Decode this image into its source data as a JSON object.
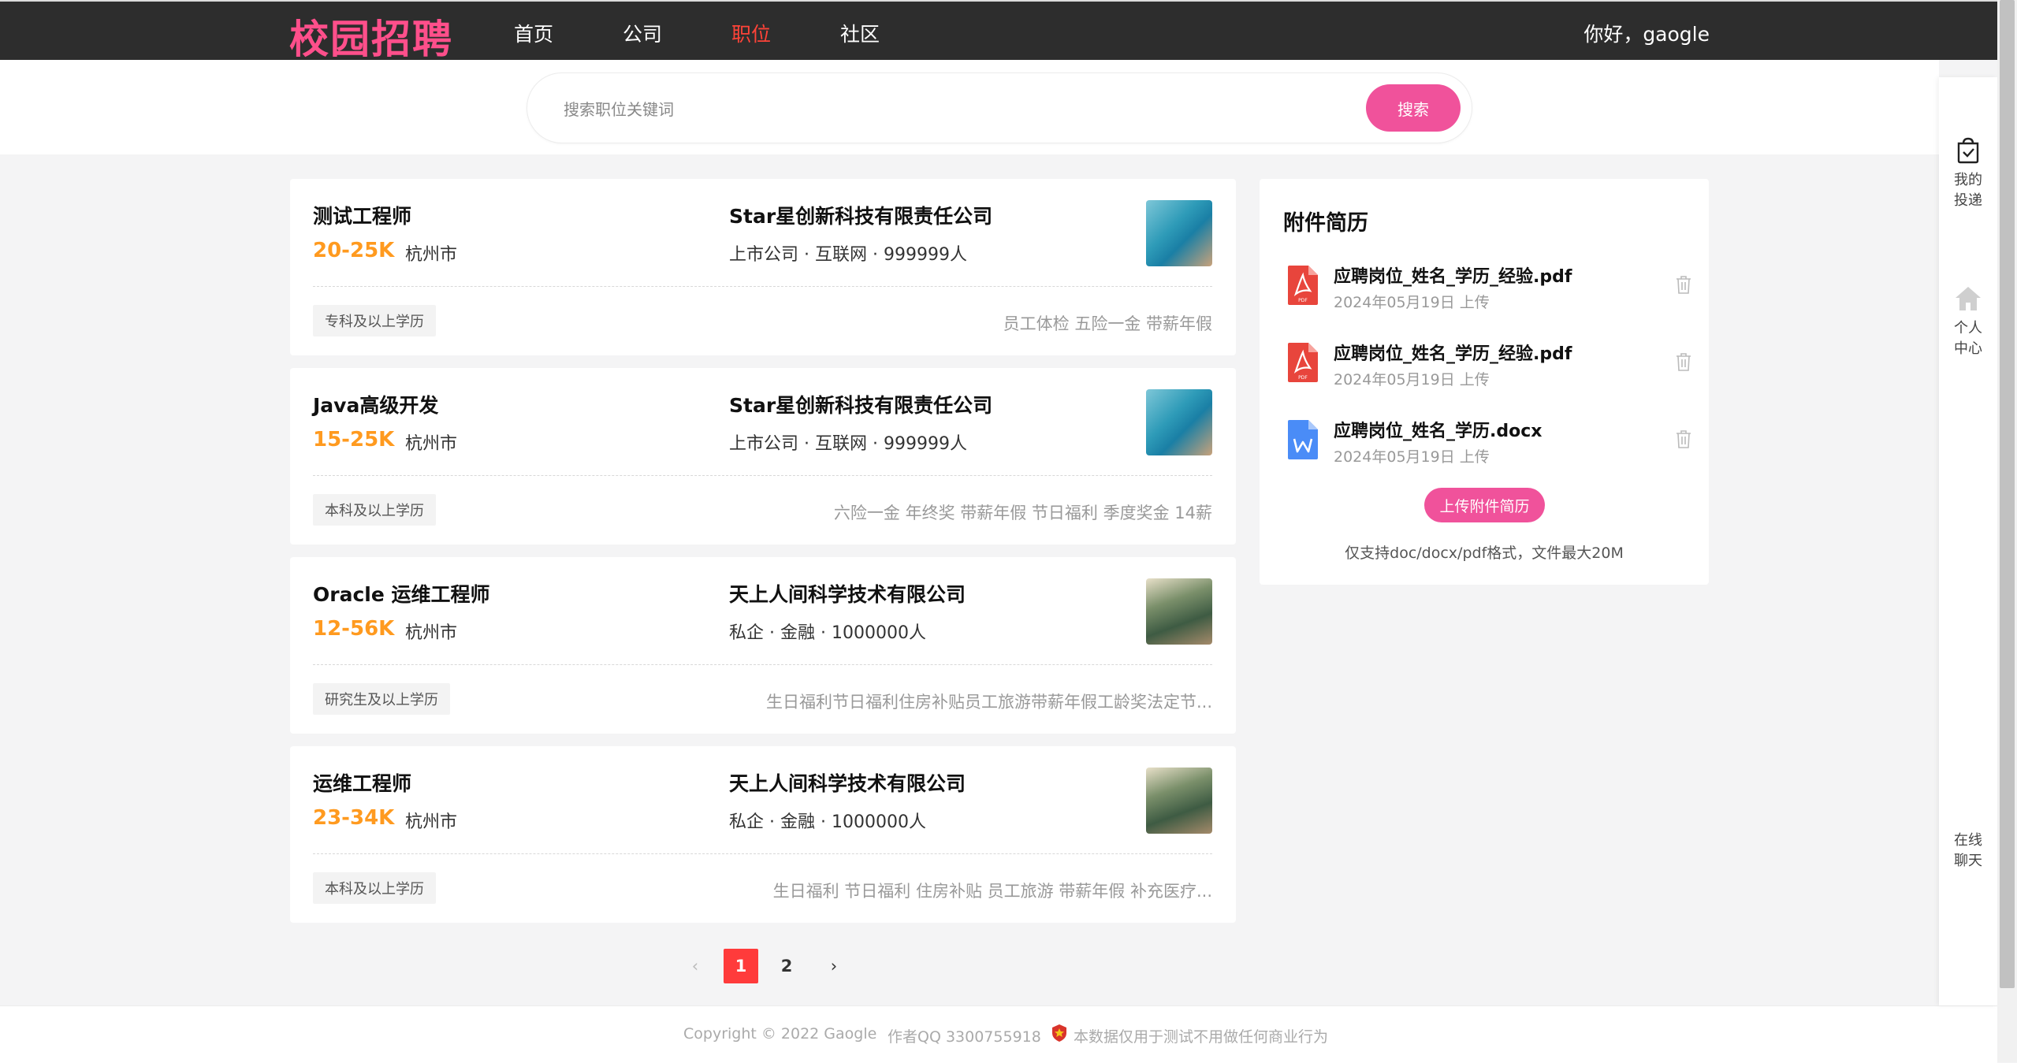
{
  "header": {
    "logo": "校园招聘",
    "nav": [
      {
        "label": "首页",
        "active": false
      },
      {
        "label": "公司",
        "active": false
      },
      {
        "label": "职位",
        "active": true
      },
      {
        "label": "社区",
        "active": false
      }
    ],
    "greeting": "你好，gaogle"
  },
  "search": {
    "placeholder": "搜索职位关键词",
    "value": "",
    "button": "搜索"
  },
  "jobs": [
    {
      "title": "测试工程师",
      "salary": "20-25K",
      "city": "杭州市",
      "company": "Star星创新科技有限责任公司",
      "company_meta": "上市公司 · 互联网 · 999999人",
      "logo": "sea-painting",
      "education": "专科及以上学历",
      "benefits": "员工体检 五险一金 带薪年假"
    },
    {
      "title": "Java高级开发",
      "salary": "15-25K",
      "city": "杭州市",
      "company": "Star星创新科技有限责任公司",
      "company_meta": "上市公司 · 互联网 · 999999人",
      "logo": "sea-painting",
      "education": "本科及以上学历",
      "benefits": "六险一金 年终奖 带薪年假 节日福利 季度奖金 14薪"
    },
    {
      "title": "Oracle 运维工程师",
      "salary": "12-56K",
      "city": "杭州市",
      "company": "天上人间科学技术有限公司",
      "company_meta": "私企 · 金融 · 1000000人",
      "logo": "forest-painting",
      "education": "研究生及以上学历",
      "benefits": "生日福利节日福利住房补贴员工旅游带薪年假工龄奖法定节..."
    },
    {
      "title": "运维工程师",
      "salary": "23-34K",
      "city": "杭州市",
      "company": "天上人间科学技术有限公司",
      "company_meta": "私企 · 金融 · 1000000人",
      "logo": "forest-painting",
      "education": "本科及以上学历",
      "benefits": "生日福利 节日福利 住房补贴 员工旅游 带薪年假 补充医疗..."
    }
  ],
  "resume": {
    "heading": "附件简历",
    "files": [
      {
        "name": "应聘岗位_姓名_学历_经验.pdf",
        "date": "2024年05月19日 上传",
        "type": "pdf"
      },
      {
        "name": "应聘岗位_姓名_学历_经验.pdf",
        "date": "2024年05月19日 上传",
        "type": "pdf"
      },
      {
        "name": "应聘岗位_姓名_学历.docx",
        "date": "2024年05月19日 上传",
        "type": "docx"
      }
    ],
    "upload_button": "上传附件简历",
    "note": "仅支持doc/docx/pdf格式，文件最大20M"
  },
  "pagination": {
    "pages": [
      "1",
      "2"
    ],
    "current": "1"
  },
  "footer": {
    "copyright": "Copyright © 2022 Gaogle",
    "author": "作者QQ 3300755918",
    "disclaimer": "本数据仅用于测试不用做任何商业行为"
  },
  "sidebar": {
    "items": [
      {
        "label": "我的投递",
        "icon": "delivery-icon"
      },
      {
        "label": "个人中心",
        "icon": "home-icon"
      },
      {
        "label": "在线聊天",
        "icon": "chat"
      }
    ]
  },
  "colors": {
    "brand_pink": "#f0529b",
    "logo_pink": "#ff4f8b",
    "nav_active": "#ff4338",
    "salary": "#ff9a1f",
    "topbar": "#2d2d2d",
    "page_active": "#ff3b3b"
  }
}
